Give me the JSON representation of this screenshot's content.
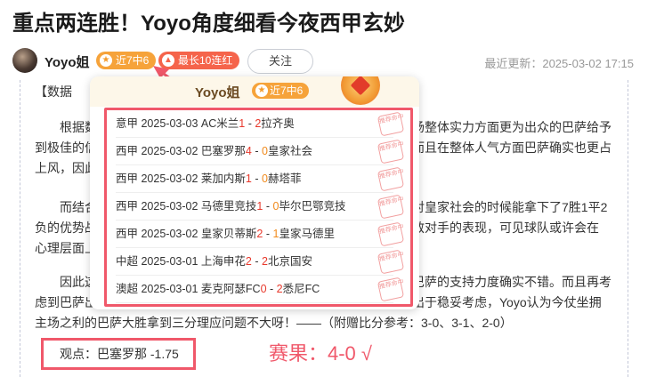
{
  "article": {
    "title": "重点两连胜！Yoyo角度细看今夜西甲玄妙",
    "author": "Yoyo姐",
    "badges": [
      "近7中6",
      "最长10连红"
    ],
    "follow_label": "关注",
    "updated": "最近更新：2025-03-02 17:15"
  },
  "body": {
    "label": "【数据",
    "p1": [
      "根据数",
      "场整体实力方面更为出众的巴萨给予",
      "到极佳的信",
      "而且在整体人气方面巴萨确实也更占",
      "上风，因此"
    ],
    "p2": [
      "而结合",
      "对皇家社会的时候能拿下了7胜1平2",
      "负的优势战",
      "敌对手的表现，可见球队或许会在",
      "心理层面上"
    ],
    "p3": [
      "因此这",
      "巴萨的支持力度确实不错。而且再考",
      "虑到巴萨出",
      "出于稳妥考虑，Yoyo认为今仗坐拥",
      "主场之利的巴萨大胜拿到三分理应问题不大呀！——（附赠比分参考：3-0、3-1、2-0）"
    ],
    "opinion": "观点：巴塞罗那 -1.75",
    "result": "赛果：4-0 √"
  },
  "record_panel": {
    "title": "Yoyo姐",
    "badge": "近7中6",
    "stamp_text": "推荐命中",
    "matches": [
      {
        "league": "意甲",
        "date": "2025-03-03",
        "home": "AC米兰",
        "hs": "1",
        "sep": " - ",
        "as": "2",
        "away": "拉齐奥"
      },
      {
        "league": "西甲",
        "date": "2025-03-02",
        "home": "巴塞罗那",
        "hs": "4",
        "sep": " - ",
        "as": "0",
        "away": "皇家社会"
      },
      {
        "league": "西甲",
        "date": "2025-03-02",
        "home": "莱加内斯",
        "hs": "1",
        "sep": " - ",
        "as": "0",
        "away": "赫塔菲"
      },
      {
        "league": "西甲",
        "date": "2025-03-02",
        "home": "马德里竞技",
        "hs": "1",
        "sep": " - ",
        "as": "0",
        "away": "毕尔巴鄂竞技"
      },
      {
        "league": "西甲",
        "date": "2025-03-02",
        "home": "皇家贝蒂斯",
        "hs": "2",
        "sep": " - ",
        "as": "1",
        "away": "皇家马德里"
      },
      {
        "league": "中超",
        "date": "2025-03-01",
        "home": "上海申花",
        "hs": "2",
        "sep": " - ",
        "as": "2",
        "away": "北京国安"
      },
      {
        "league": "澳超",
        "date": "2025-03-01",
        "home": "麦克阿瑟FC",
        "hs": "0",
        "sep": " - ",
        "as": "2",
        "away": "悉尼FC"
      }
    ]
  },
  "colors": {
    "accent": "#f0586a",
    "badge_orange": "#f6a33a",
    "badge_red": "#f5644b",
    "score_red": "#e8392c"
  }
}
